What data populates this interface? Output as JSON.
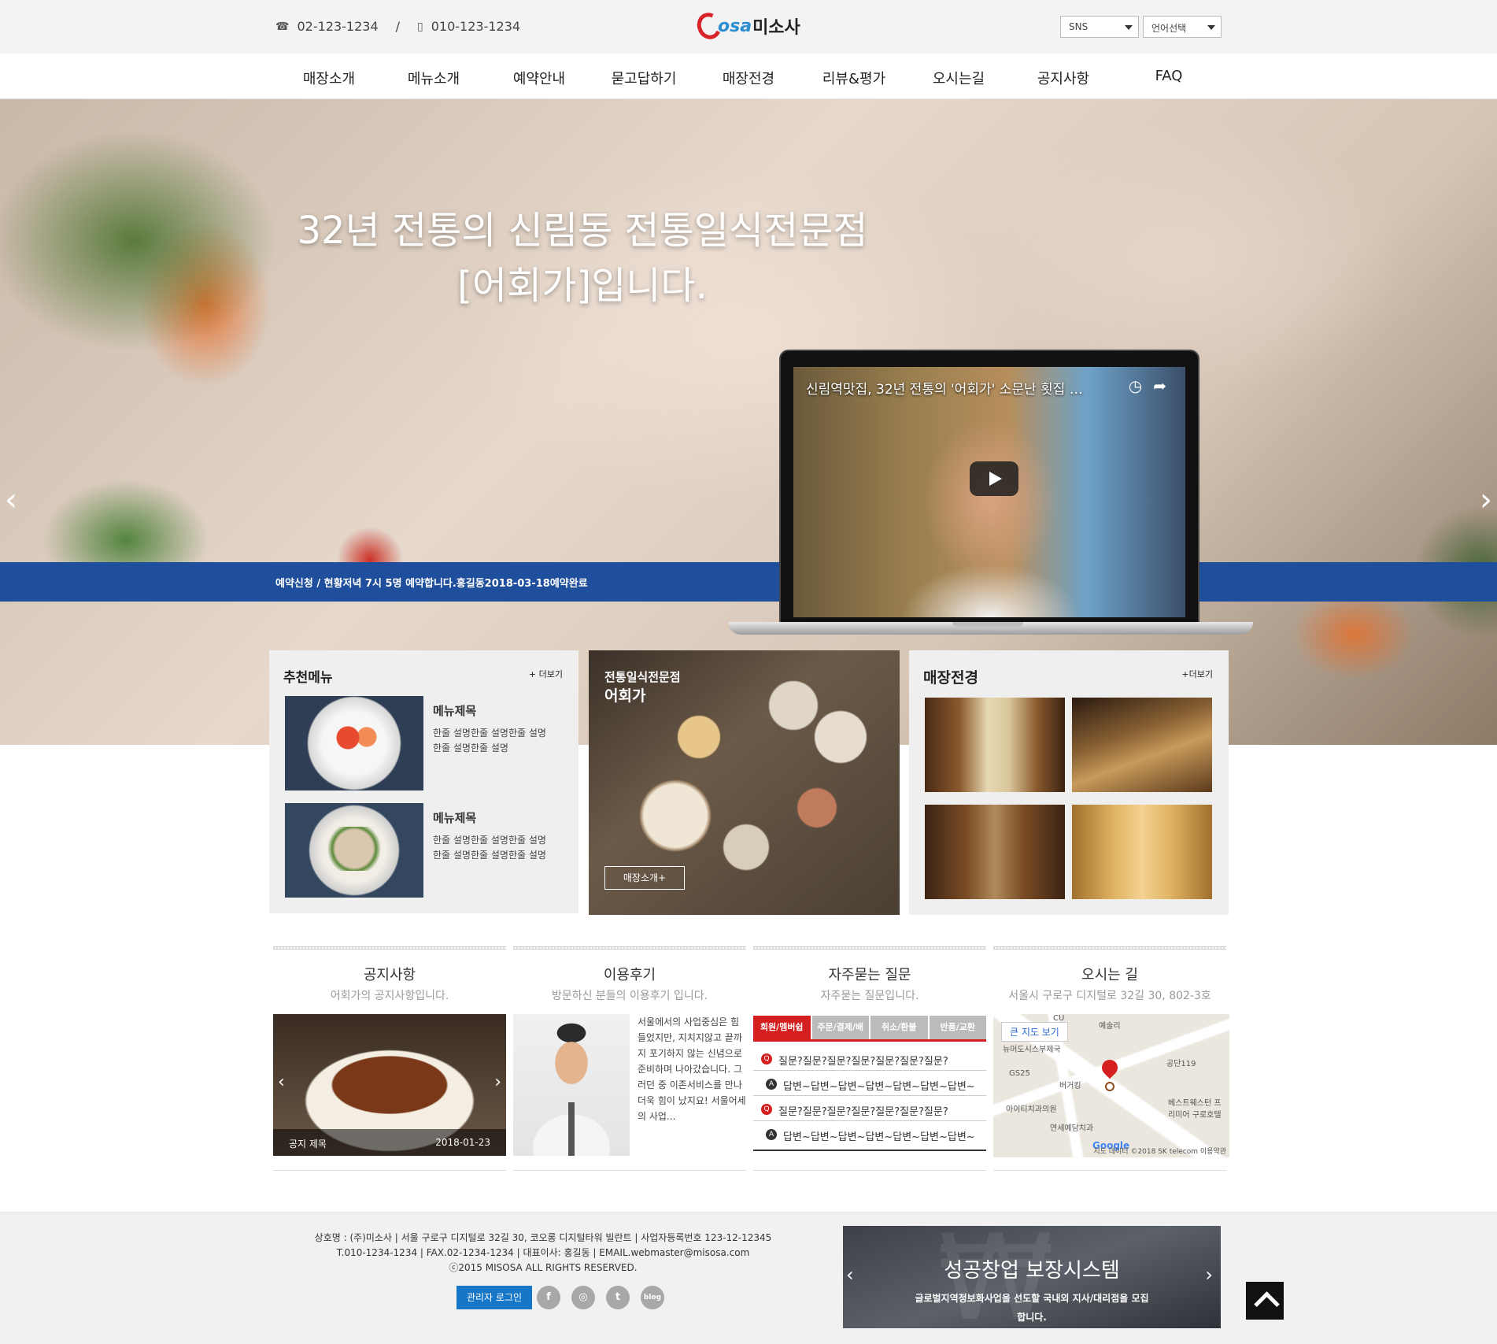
{
  "header": {
    "phone1": "02-123-1234",
    "separator": "/",
    "phone2": "010-123-1234",
    "logo_osa": "osa",
    "logo_ko": "미소사",
    "sns_select": "SNS",
    "lang_select": "언어선택"
  },
  "nav": {
    "items": [
      "매장소개",
      "메뉴소개",
      "예약안내",
      "묻고답하기",
      "매장전경",
      "리뷰&평가",
      "오시는길",
      "공지사항",
      "FAQ"
    ]
  },
  "hero": {
    "title_line1": "32년 전통의 신림동 전통일식전문점",
    "title_line2": "[어회가]입니다.",
    "ticker": "예약신청 / 현황저녁 7시 5명 예약합니다.홍길동2018-03-18예약완료",
    "video_title": "신림역맛집, 32년 전통의 '어회가' 소문난 횟집 김...",
    "prev": "‹",
    "next": "›"
  },
  "recommend": {
    "title": "추천메뉴",
    "more": "+ 더보기",
    "items": [
      {
        "name": "메뉴제목",
        "desc": "한줄 설명한줄 설명한줄 설명 한줄 설명한줄 설명"
      },
      {
        "name": "메뉴제목",
        "desc": "한줄 설명한줄 설명한줄 설명 한줄 설명한줄 설명한줄 설명"
      }
    ]
  },
  "feature": {
    "title": "전통일식전문점",
    "subtitle": "어회가",
    "button": "매장소개+"
  },
  "store": {
    "title": "매장전경",
    "more": "+더보기"
  },
  "notice": {
    "title": "공지사항",
    "subtitle": "어회가의 공지사항입니다.",
    "item_title": "공지 제목",
    "item_date": "2018-01-23"
  },
  "review": {
    "title": "이용후기",
    "subtitle": "방문하신 분들의 이용후기 입니다.",
    "text": "서울에서의 사업중심은 힘들었지만, 지치지않고 끝까지 포기하지 않는 신념으로 준비하며 나아갔습니다. 그러던 중 이존서비스를 만나 더욱 힘이 났지요! 서울어세의 사업..."
  },
  "faq": {
    "title": "자주묻는 질문",
    "subtitle": "자주묻는 질문입니다.",
    "tabs": [
      "회원/멤버쉽",
      "주문/결제/배",
      "취소/환불",
      "반품/교환"
    ],
    "q1": "질문?질문?질문?질문?질문?질문?질문?",
    "a1": "답변~답변~답변~답변~답변~답변~답변~",
    "q2": "질문?질문?질문?질문?질문?질문?질문?",
    "a2": "답변~답변~답변~답변~답변~답변~답변~",
    "q_mark": "Q",
    "a_mark": "A"
  },
  "location": {
    "title": "오시는 길",
    "subtitle": "서울시 구로구 디지털로 32길 30, 802-3호",
    "map_button": "큰 지도 보기",
    "labels": [
      "CU",
      "예술리",
      "뉴머도시스부제국",
      "GS25",
      "버거킹",
      "공단119",
      "아이티치과의원",
      "베스트웨스턴 프리미어 구로호텔",
      "연세예담치과"
    ],
    "google": "Google",
    "copyright": "지도 데이터 ©2018 SK telecom   이용약관"
  },
  "footer": {
    "line1": "상호명 : (주)미소사 | 서울 구로구 디지털로 32길 30, 코오롱 디지털타워 빌란트 | 사업자등록번호 123-12-12345",
    "line2": "T.010-1234-1234 | FAX.02-1234-1234 | 대표이사: 홍길동 | EMAIL.webmaster@misosa.com",
    "line3": "ⓒ2015 MISOSA ALL RIGHTS RESERVED.",
    "admin": "관리자 로그인",
    "sns_facebook": "f",
    "sns_instagram": "◎",
    "sns_twitter": "t",
    "sns_blog": "blog"
  },
  "banner": {
    "title": "성공창업 보장시스템",
    "sub": "글로벌지역정보화사업을 선도할 국내외 지사/대리점을 모집합니다.",
    "prev": "‹",
    "next": "›"
  }
}
